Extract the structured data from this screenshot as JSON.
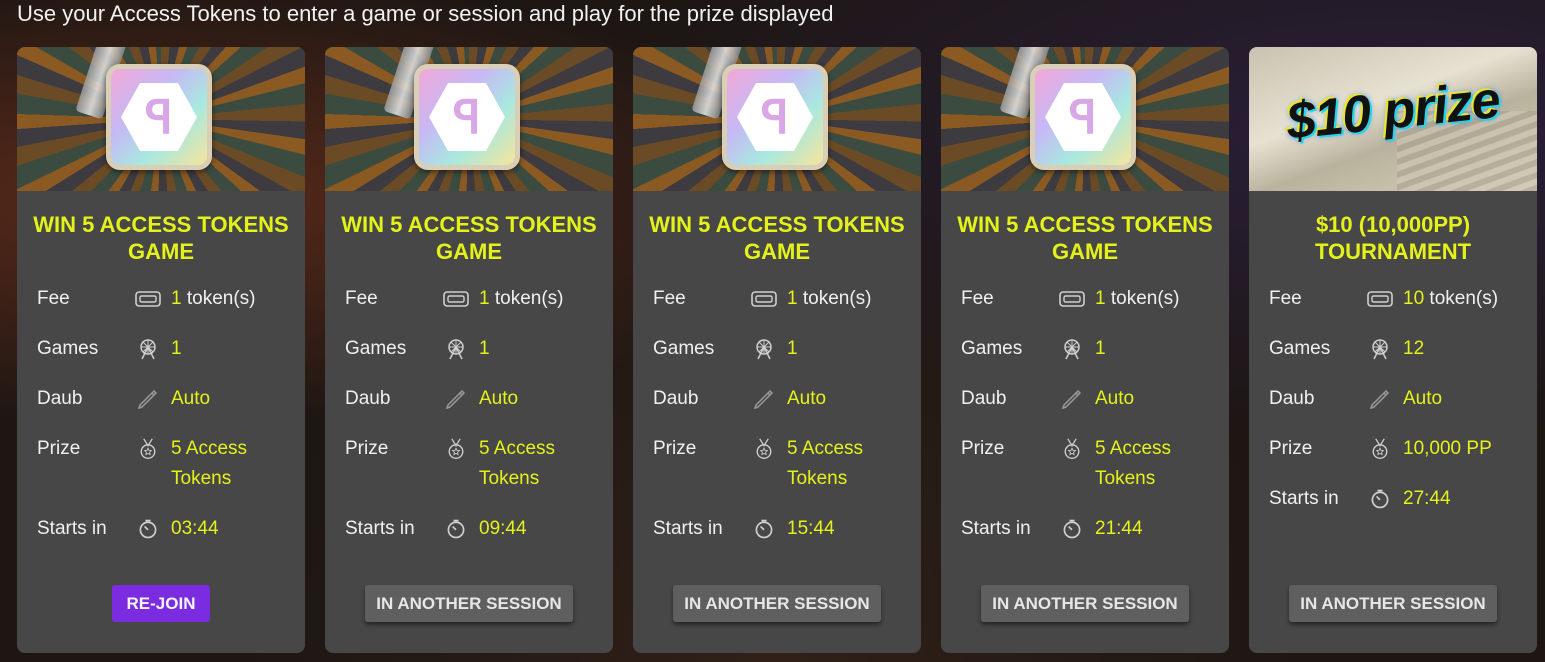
{
  "header": {
    "text": "Use your Access Tokens to enter a game or session and play for the prize displayed"
  },
  "labels": {
    "fee": "Fee",
    "games": "Games",
    "daub": "Daub",
    "prize": "Prize",
    "starts": "Starts in"
  },
  "cards": [
    {
      "title_line1": "WIN 5 ACCESS TOKENS",
      "title_line2": "GAME",
      "fee_value": "1",
      "fee_suffix": " token(s)",
      "games": "1",
      "daub": "Auto",
      "prize_line1": "5 Access",
      "prize_line2": "Tokens",
      "starts_in": "03:44",
      "button": "RE-JOIN"
    },
    {
      "title_line1": "WIN 5 ACCESS TOKENS",
      "title_line2": "GAME",
      "fee_value": "1",
      "fee_suffix": " token(s)",
      "games": "1",
      "daub": "Auto",
      "prize_line1": "5 Access",
      "prize_line2": "Tokens",
      "starts_in": "09:44",
      "button": "IN ANOTHER SESSION"
    },
    {
      "title_line1": "WIN 5 ACCESS TOKENS",
      "title_line2": "GAME",
      "fee_value": "1",
      "fee_suffix": " token(s)",
      "games": "1",
      "daub": "Auto",
      "prize_line1": "5 Access",
      "prize_line2": "Tokens",
      "starts_in": "15:44",
      "button": "IN ANOTHER SESSION"
    },
    {
      "title_line1": "WIN 5 ACCESS TOKENS",
      "title_line2": "GAME",
      "fee_value": "1",
      "fee_suffix": " token(s)",
      "games": "1",
      "daub": "Auto",
      "prize_line1": "5 Access",
      "prize_line2": "Tokens",
      "starts_in": "21:44",
      "button": "IN ANOTHER SESSION"
    },
    {
      "title_line1": "$10 (10,000PP)",
      "title_line2": "TOURNAMENT",
      "banner_text": "$10 prize",
      "fee_value": "10",
      "fee_suffix": " token(s)",
      "games": "12",
      "daub": "Auto",
      "prize_line1": "10,000 PP",
      "starts_in": "27:44",
      "button": "IN ANOTHER SESSION"
    }
  ],
  "colors": {
    "accent": "#e4f21a",
    "card_bg": "#474747",
    "primary_button": "#7b2be0",
    "secondary_button": "#5f5f5f"
  },
  "icons": {
    "fee": "ticket-icon",
    "games": "ferris-wheel-icon",
    "daub": "dauber-pen-icon",
    "prize": "medal-icon",
    "starts": "stopwatch-icon"
  }
}
